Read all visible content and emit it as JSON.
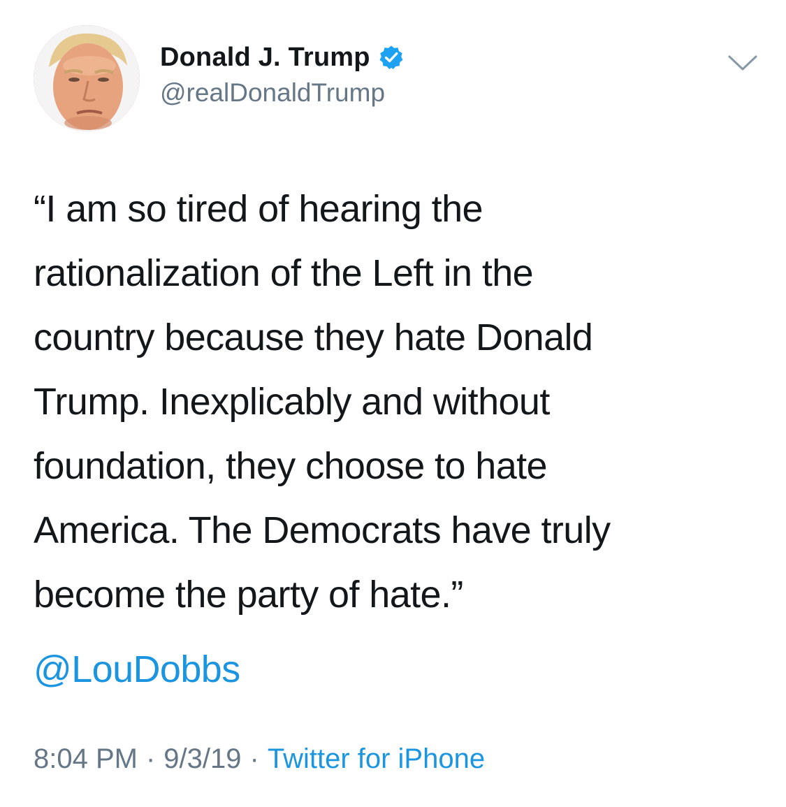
{
  "tweet": {
    "author": {
      "display_name": "Donald J. Trump",
      "handle": "@realDonaldTrump",
      "verified": true
    },
    "body_lines": [
      "“I am so tired of hearing the",
      "rationalization of the Left in the",
      "country because they hate Donald",
      "Trump. Inexplicably and without",
      "foundation, they choose to hate",
      "America. The Democrats have truly",
      "become the party of hate.”"
    ],
    "mention": "@LouDobbs",
    "time": "8:04 PM",
    "separator": "·",
    "date": "9/3/19",
    "source": "Twitter for iPhone"
  },
  "icons": {
    "verified": "verified-badge-icon",
    "menu": "chevron-down-icon"
  },
  "colors": {
    "text": "#14171a",
    "secondary": "#657786",
    "link": "#1b95e0",
    "verified": "#1da1f2"
  }
}
